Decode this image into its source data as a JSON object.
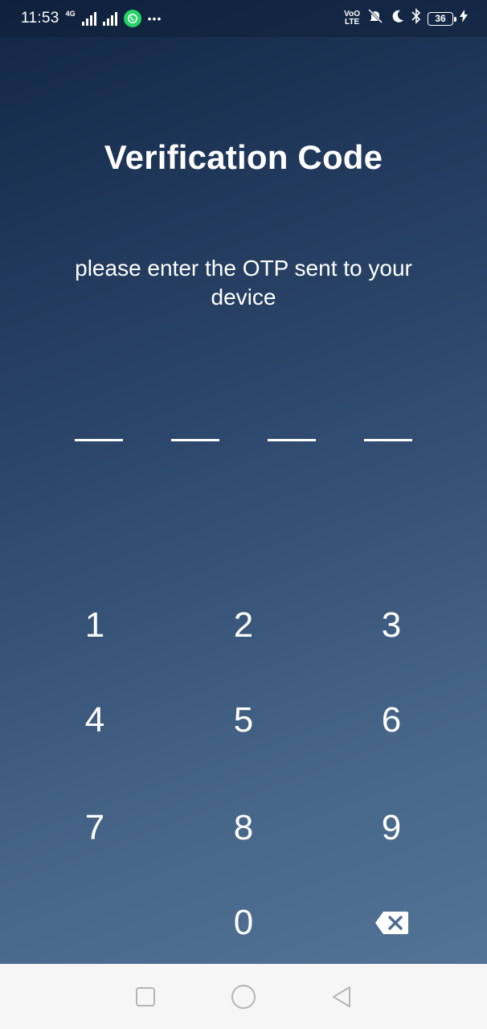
{
  "status_bar": {
    "time": "11:53",
    "network_tag": "4G",
    "volte_label_top": "VoO",
    "volte_label_bottom": "LTE",
    "battery_level": "36",
    "icons": [
      "signal-icon",
      "whatsapp-icon",
      "more-dots-icon",
      "volte-icon",
      "mute-icon",
      "moon-icon",
      "bluetooth-icon",
      "battery-icon",
      "charging-icon"
    ]
  },
  "screen": {
    "title": "Verification Code",
    "subtitle": "please enter the OTP sent to your device",
    "otp_length": 4
  },
  "keypad": {
    "keys": [
      "1",
      "2",
      "3",
      "4",
      "5",
      "6",
      "7",
      "8",
      "9",
      "0"
    ],
    "backspace_icon": "backspace-icon"
  },
  "nav_bar": {
    "icons": [
      "recents-icon",
      "home-icon",
      "back-icon"
    ]
  },
  "colors": {
    "gradient_top": "#122646",
    "gradient_bottom": "#577799",
    "text": "#ffffff",
    "nav_bar_bg": "#f6f6f6",
    "nav_icon": "#b5b5b5",
    "whatsapp_green": "#25d366"
  }
}
